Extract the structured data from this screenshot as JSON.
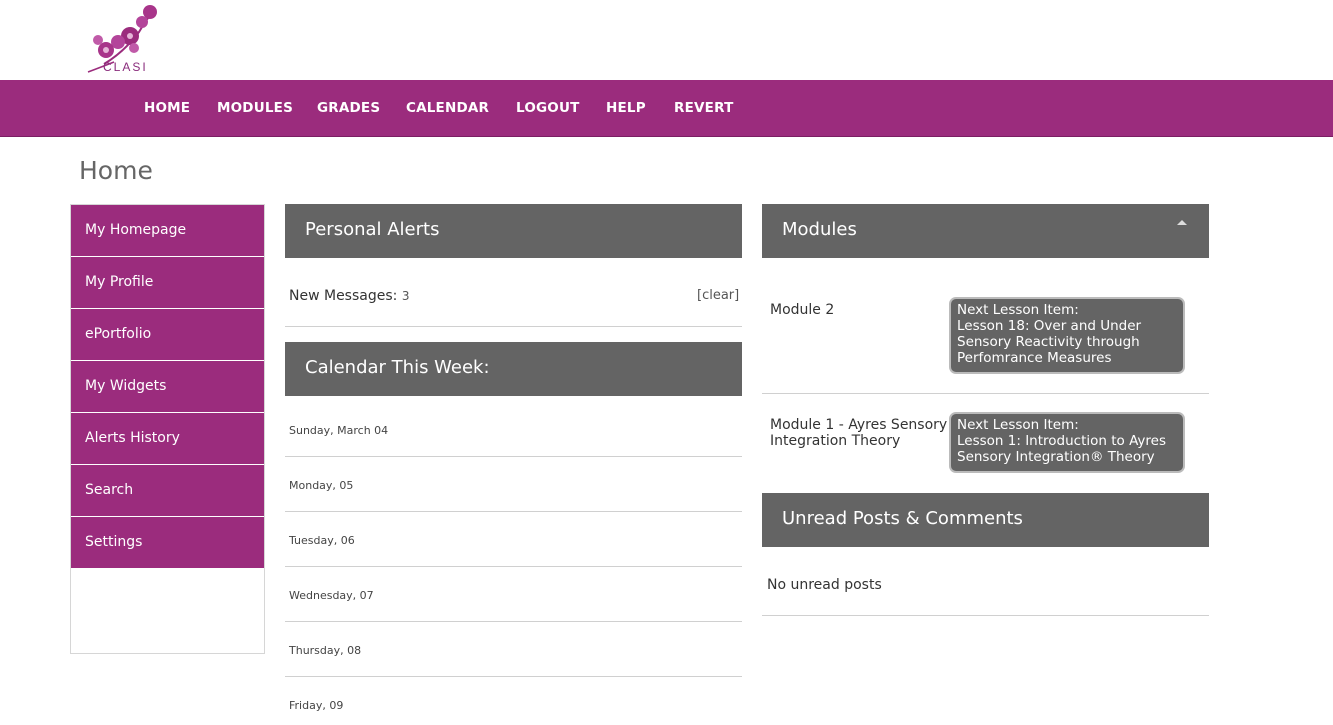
{
  "brand": {
    "logo_text": "CLASI",
    "accent": "#9b2c7d",
    "panel": "#646464"
  },
  "nav": {
    "items": [
      {
        "label": "HOME"
      },
      {
        "label": "MODULES"
      },
      {
        "label": "GRADES"
      },
      {
        "label": "CALENDAR"
      },
      {
        "label": "LOGOUT"
      },
      {
        "label": "HELP"
      },
      {
        "label": "REVERT"
      }
    ]
  },
  "page": {
    "title": "Home"
  },
  "sidebar": {
    "items": [
      {
        "label": "My Homepage"
      },
      {
        "label": "My Profile"
      },
      {
        "label": "ePortfolio"
      },
      {
        "label": "My Widgets"
      },
      {
        "label": "Alerts History"
      },
      {
        "label": "Search"
      },
      {
        "label": "Settings"
      }
    ]
  },
  "alerts": {
    "title": "Personal Alerts",
    "messages_label": "New Messages:",
    "messages_count": "3",
    "clear_label": "[clear]"
  },
  "calendar": {
    "title": "Calendar This Week:",
    "days": [
      {
        "label": "Sunday, March 04"
      },
      {
        "label": "Monday, 05"
      },
      {
        "label": "Tuesday, 06"
      },
      {
        "label": "Wednesday, 07"
      },
      {
        "label": "Thursday, 08"
      },
      {
        "label": "Friday, 09"
      }
    ]
  },
  "modules": {
    "title": "Modules",
    "items": [
      {
        "name_line1": "Module 2",
        "name_line2": "",
        "next_label": "Next Lesson Item:",
        "lesson_lines": [
          "Lesson 18: Over and Under",
          "Sensory Reactivity through",
          "Perfomrance Measures"
        ]
      },
      {
        "name_line1": "Module 1 - Ayres Sensory",
        "name_line2": "Integration Theory",
        "next_label": "Next Lesson Item:",
        "lesson_lines": [
          "Lesson 1: Introduction to Ayres",
          "Sensory Integration® Theory"
        ]
      }
    ]
  },
  "unread": {
    "title": "Unread Posts & Comments",
    "empty_text": "No unread posts"
  }
}
